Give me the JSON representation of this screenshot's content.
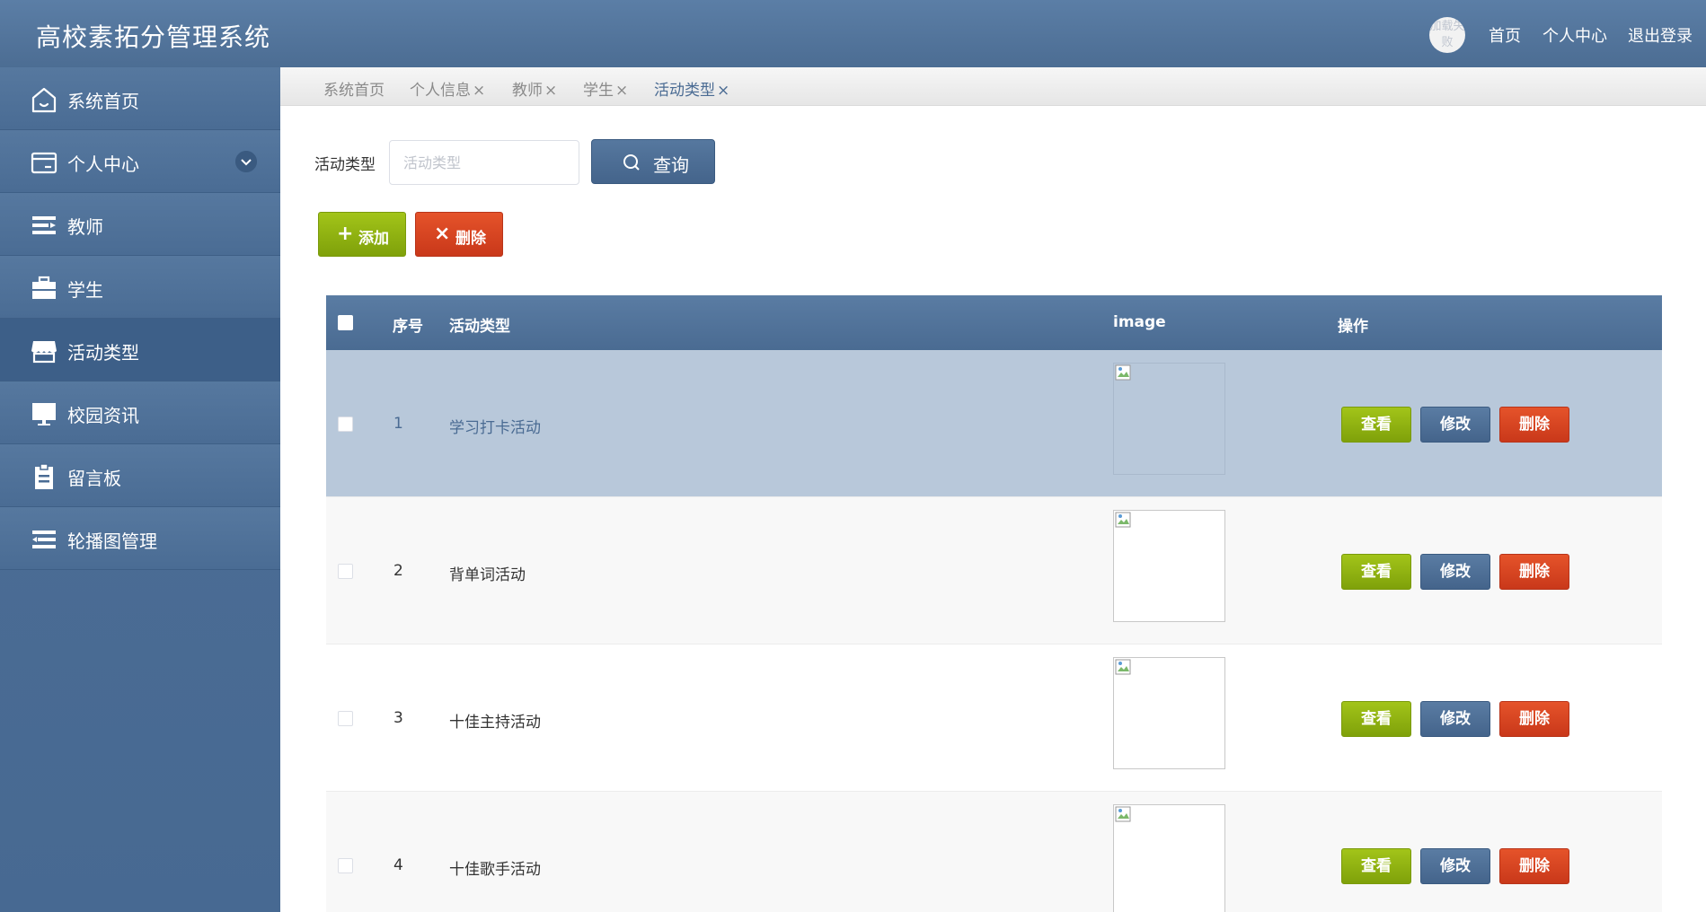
{
  "app": {
    "title": "高校素拓分管理系统"
  },
  "header": {
    "avatar_alt": "加载失败",
    "home": "首页",
    "profile": "个人中心",
    "logout": "退出登录"
  },
  "sidebar": {
    "items": [
      {
        "label": "系统首页",
        "icon": "home-icon"
      },
      {
        "label": "个人中心",
        "icon": "wallet-icon"
      },
      {
        "label": "教师",
        "icon": "list-icon"
      },
      {
        "label": "学生",
        "icon": "briefcase-icon"
      },
      {
        "label": "活动类型",
        "icon": "store-icon",
        "active": true
      },
      {
        "label": "校园资讯",
        "icon": "monitor-icon"
      },
      {
        "label": "留言板",
        "icon": "clipboard-icon"
      },
      {
        "label": "轮播图管理",
        "icon": "menu-lines-icon"
      }
    ]
  },
  "tabs": [
    {
      "label": "系统首页"
    },
    {
      "label": "个人信息",
      "close": "×"
    },
    {
      "label": "教师",
      "close": "×"
    },
    {
      "label": "学生",
      "close": "×"
    },
    {
      "label": "活动类型",
      "close": "×",
      "active": true
    }
  ],
  "search": {
    "label": "活动类型",
    "placeholder": "活动类型",
    "value": "",
    "button": "查询"
  },
  "actions": {
    "add": "添加",
    "delete": "删除"
  },
  "table": {
    "columns": [
      "序号",
      "活动类型",
      "image",
      "操作"
    ],
    "rows": [
      {
        "index": "1",
        "type": "学习打卡活动"
      },
      {
        "index": "2",
        "type": "背单词活动"
      },
      {
        "index": "3",
        "type": "十佳主持活动"
      },
      {
        "index": "4",
        "type": "十佳歌手活动"
      }
    ],
    "row_actions": {
      "view": "查看",
      "edit": "修改",
      "delete": "删除"
    }
  },
  "colors": {
    "primary": "#4a6b93",
    "green": "#8db010",
    "red": "#d9431f",
    "selected_row": "#b8c8da"
  }
}
